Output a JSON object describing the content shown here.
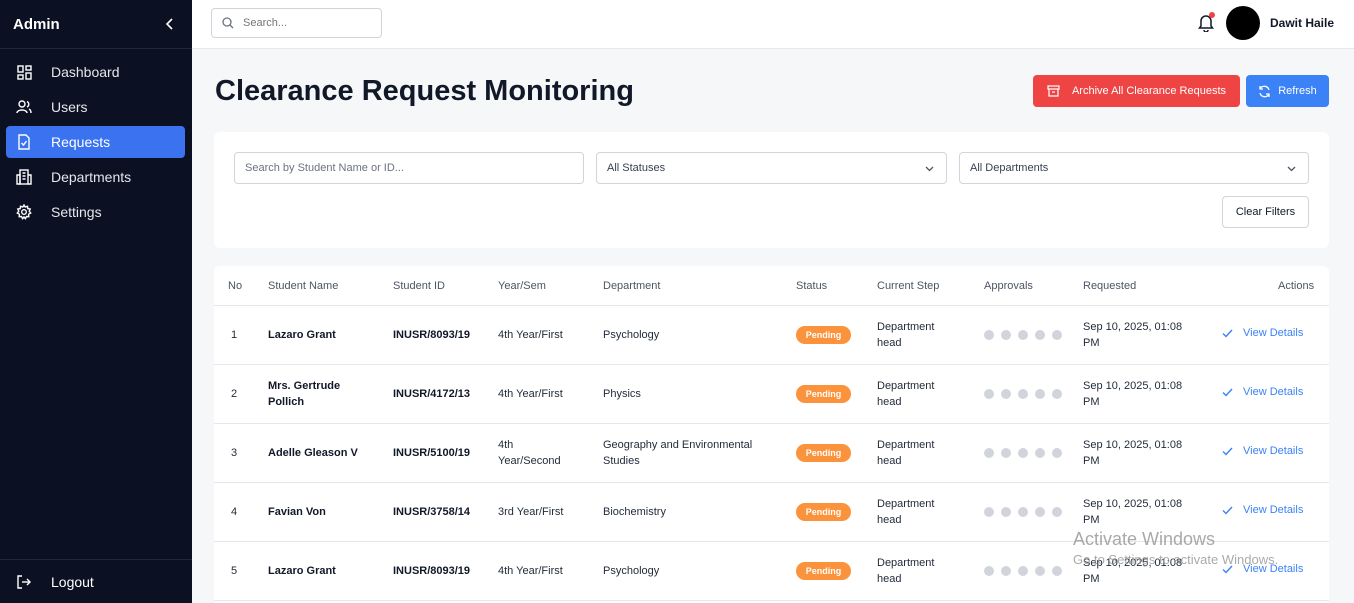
{
  "sidebar": {
    "title": "Admin",
    "items": [
      {
        "label": "Dashboard",
        "icon": "dashboard-icon",
        "active": false
      },
      {
        "label": "Users",
        "icon": "users-icon",
        "active": false
      },
      {
        "label": "Requests",
        "icon": "requests-icon",
        "active": true
      },
      {
        "label": "Departments",
        "icon": "departments-icon",
        "active": false
      },
      {
        "label": "Settings",
        "icon": "gear-icon",
        "active": false
      }
    ],
    "logout_label": "Logout"
  },
  "topbar": {
    "search_placeholder": "Search...",
    "user_name": "Dawit Haile"
  },
  "main": {
    "title": "Clearance Request Monitoring",
    "archive_label": "Archive All Clearance Requests",
    "refresh_label": "Refresh"
  },
  "filters": {
    "search_placeholder": "Search by Student Name or ID...",
    "status_value": "All Statuses",
    "department_value": "All Departments",
    "clear_label": "Clear Filters"
  },
  "table": {
    "headers": [
      "No",
      "Student Name",
      "Student ID",
      "Year/Sem",
      "Department",
      "Status",
      "Current Step",
      "Approvals",
      "Requested",
      "Actions"
    ],
    "rows": [
      {
        "no": "1",
        "name_l1": "Lazaro Grant",
        "name_l2": "",
        "id": "INUSR/8093/19",
        "year_l1": "4th Year/First",
        "year_l2": "",
        "dept_l1": "Psychology",
        "dept_l2": "",
        "status": "Pending",
        "step_l1": "Department",
        "step_l2": "head",
        "approvals_pending": 5,
        "req_l1": "Sep 10, 2025, 01:08",
        "req_l2": "PM",
        "action": "View Details"
      },
      {
        "no": "2",
        "name_l1": "Mrs. Gertrude",
        "name_l2": "Pollich",
        "id": "INUSR/4172/13",
        "year_l1": "4th Year/First",
        "year_l2": "",
        "dept_l1": "Physics",
        "dept_l2": "",
        "status": "Pending",
        "step_l1": "Department",
        "step_l2": "head",
        "approvals_pending": 5,
        "req_l1": "Sep 10, 2025, 01:08",
        "req_l2": "PM",
        "action": "View Details"
      },
      {
        "no": "3",
        "name_l1": "Adelle Gleason V",
        "name_l2": "",
        "id": "INUSR/5100/19",
        "year_l1": "4th",
        "year_l2": "Year/Second",
        "dept_l1": "Geography and Environmental",
        "dept_l2": "Studies",
        "status": "Pending",
        "step_l1": "Department",
        "step_l2": "head",
        "approvals_pending": 5,
        "req_l1": "Sep 10, 2025, 01:08",
        "req_l2": "PM",
        "action": "View Details"
      },
      {
        "no": "4",
        "name_l1": "Favian Von",
        "name_l2": "",
        "id": "INUSR/3758/14",
        "year_l1": "3rd Year/First",
        "year_l2": "",
        "dept_l1": "Biochemistry",
        "dept_l2": "",
        "status": "Pending",
        "step_l1": "Department",
        "step_l2": "head",
        "approvals_pending": 5,
        "req_l1": "Sep 10, 2025, 01:08",
        "req_l2": "PM",
        "action": "View Details"
      },
      {
        "no": "5",
        "name_l1": "Lazaro Grant",
        "name_l2": "",
        "id": "INUSR/8093/19",
        "year_l1": "4th Year/First",
        "year_l2": "",
        "dept_l1": "Psychology",
        "dept_l2": "",
        "status": "Pending",
        "step_l1": "Department",
        "step_l2": "head",
        "approvals_pending": 5,
        "req_l1": "Sep 10, 2025, 01:08",
        "req_l2": "PM",
        "action": "View Details"
      }
    ]
  },
  "watermark": {
    "line1": "Activate Windows",
    "line2": "Go to Settings to activate Windows."
  },
  "colors": {
    "sidebar_bg": "#0b1122",
    "accent": "#3b72f0",
    "danger": "#ef4444",
    "pending": "#fb923c"
  }
}
